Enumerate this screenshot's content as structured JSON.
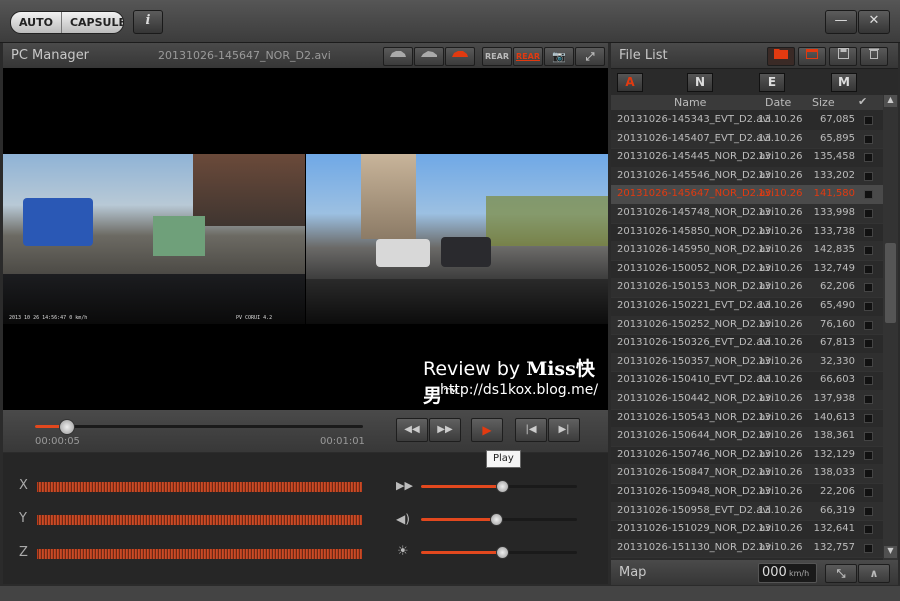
{
  "app": {
    "mode_auto": "AUTO",
    "mode_capsule": "CAPSULE",
    "info_label": "i",
    "minimize_label": "—",
    "close_label": "✕"
  },
  "viewer": {
    "title": "PC Manager",
    "filename": "20131026-145647_NOR_D2.avi",
    "toolbar": {
      "rear1": "REAR",
      "rear2": "REAR"
    },
    "overlay_credit": "Review by",
    "overlay_brand": "Miss快男™",
    "overlay_url": "http://ds1kox.blog.me/",
    "cam_left_stamp": "2013 10 26 14:56:47  0 km/h",
    "cam_right_stamp": "PV  CORUI 4.2"
  },
  "playback": {
    "current_time": "00:00:05",
    "total_time": "00:01:01",
    "progress_fraction": 0.09,
    "tooltip": "Play",
    "rewind_icon": "◀◀",
    "forward_icon": "▶▶",
    "play_icon": "▶",
    "prev_icon": "|◀",
    "next_icon": "▶|"
  },
  "sensors": {
    "axes": [
      "X",
      "Y",
      "Z"
    ],
    "speed_level": 0.52,
    "volume_level": 0.48,
    "brightness_level": 0.52
  },
  "file_list": {
    "title": "File List",
    "filters": [
      "A",
      "N",
      "E",
      "M"
    ],
    "columns": {
      "name": "Name",
      "date": "Date",
      "size": "Size",
      "check": "✔"
    },
    "selected_index": 4,
    "rows": [
      {
        "name": "20131026-145343_EVT_D2.avi",
        "date": "13.10.26",
        "size": "67,085"
      },
      {
        "name": "20131026-145407_EVT_D2.avi",
        "date": "13.10.26",
        "size": "65,895"
      },
      {
        "name": "20131026-145445_NOR_D2.avi",
        "date": "13.10.26",
        "size": "135,458"
      },
      {
        "name": "20131026-145546_NOR_D2.avi",
        "date": "13.10.26",
        "size": "133,202"
      },
      {
        "name": "20131026-145647_NOR_D2.avi",
        "date": "13.10.26",
        "size": "141,580"
      },
      {
        "name": "20131026-145748_NOR_D2.avi",
        "date": "13.10.26",
        "size": "133,998"
      },
      {
        "name": "20131026-145850_NOR_D2.avi",
        "date": "13.10.26",
        "size": "133,738"
      },
      {
        "name": "20131026-145950_NOR_D2.avi",
        "date": "13.10.26",
        "size": "142,835"
      },
      {
        "name": "20131026-150052_NOR_D2.avi",
        "date": "13.10.26",
        "size": "132,749"
      },
      {
        "name": "20131026-150153_NOR_D2.avi",
        "date": "13.10.26",
        "size": "62,206"
      },
      {
        "name": "20131026-150221_EVT_D2.avi",
        "date": "13.10.26",
        "size": "65,490"
      },
      {
        "name": "20131026-150252_NOR_D2.avi",
        "date": "13.10.26",
        "size": "76,160"
      },
      {
        "name": "20131026-150326_EVT_D2.avi",
        "date": "13.10.26",
        "size": "67,813"
      },
      {
        "name": "20131026-150357_NOR_D2.avi",
        "date": "13.10.26",
        "size": "32,330"
      },
      {
        "name": "20131026-150410_EVT_D2.avi",
        "date": "13.10.26",
        "size": "66,603"
      },
      {
        "name": "20131026-150442_NOR_D2.avi",
        "date": "13.10.26",
        "size": "137,938"
      },
      {
        "name": "20131026-150543_NOR_D2.avi",
        "date": "13.10.26",
        "size": "140,613"
      },
      {
        "name": "20131026-150644_NOR_D2.avi",
        "date": "13.10.26",
        "size": "138,361"
      },
      {
        "name": "20131026-150746_NOR_D2.avi",
        "date": "13.10.26",
        "size": "132,129"
      },
      {
        "name": "20131026-150847_NOR_D2.avi",
        "date": "13.10.26",
        "size": "138,033"
      },
      {
        "name": "20131026-150948_NOR_D2.avi",
        "date": "13.10.26",
        "size": "22,206"
      },
      {
        "name": "20131026-150958_EVT_D2.avi",
        "date": "13.10.26",
        "size": "66,319"
      },
      {
        "name": "20131026-151029_NOR_D2.avi",
        "date": "13.10.26",
        "size": "132,641"
      },
      {
        "name": "20131026-151130_NOR_D2.avi",
        "date": "13.10.26",
        "size": "132,757"
      }
    ]
  },
  "map": {
    "title": "Map",
    "speed_value": "000",
    "speed_unit": "km/h",
    "expand_icon": "⤡",
    "collapse_icon": "∧"
  },
  "colors": {
    "accent": "#e23a10",
    "panel": "#2b2b2b"
  }
}
